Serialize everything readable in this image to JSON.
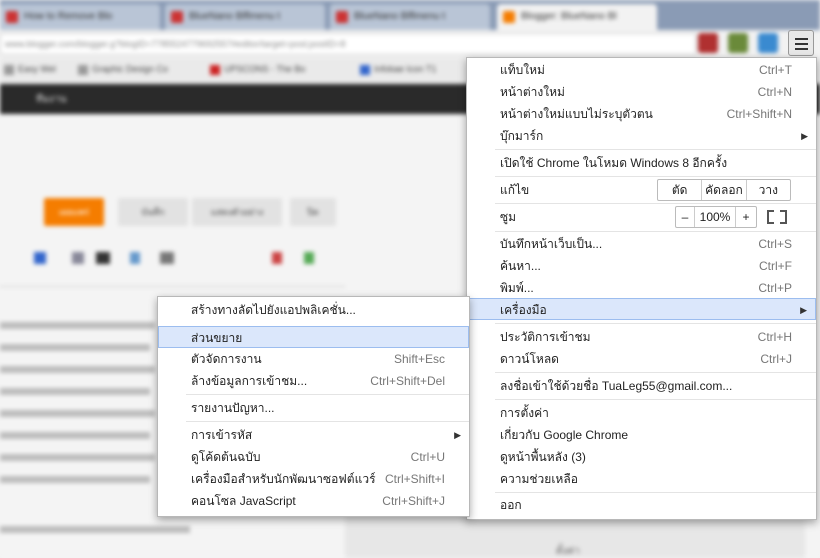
{
  "background": {
    "tabs": [
      {
        "label": "How to Remove Blo"
      },
      {
        "label": "BlueNano Blflmenu t"
      },
      {
        "label": "BlueNano Blflmenu t"
      },
      {
        "label": "Blogger: BlueNano Bl"
      }
    ],
    "omnibox_text": "www.blogger.com/blogger.g?blogID=7785524779692557#editor/target=post;postID=8",
    "bookmarks": [
      "Easy Wel",
      "Graphic Design Co",
      "UPSCONS - The Bo",
      "Infobae Icon T1"
    ],
    "darkbar": [
      "",
      "ทีมงาน"
    ],
    "editor_buttons": [
      "เผยแพร่",
      "บันทึก",
      "แสดงตัวอย่าง",
      "ปิด"
    ],
    "sidebar_label": "ตั้งค่า"
  },
  "main_menu": {
    "items": {
      "new_tab": {
        "label": "แท็บใหม่",
        "shortcut": "Ctrl+T"
      },
      "new_window": {
        "label": "หน้าต่างใหม่",
        "shortcut": "Ctrl+N"
      },
      "incognito": {
        "label": "หน้าต่างใหม่แบบไม่ระบุตัวตน",
        "shortcut": "Ctrl+Shift+N"
      },
      "bookmarks": {
        "label": "บุ๊กมาร์ก"
      },
      "win8": {
        "label": "เปิดใช้ Chrome ในโหมด Windows 8 อีกครั้ง"
      },
      "edit": {
        "label": "แก้ไข",
        "cut": "ตัด",
        "copy": "คัดลอก",
        "paste": "วาง"
      },
      "zoom": {
        "label": "ซูม",
        "minus": "–",
        "value": "100%",
        "plus": "+"
      },
      "save_page": {
        "label": "บันทึกหน้าเว็บเป็น...",
        "shortcut": "Ctrl+S"
      },
      "find": {
        "label": "ค้นหา...",
        "shortcut": "Ctrl+F"
      },
      "print": {
        "label": "พิมพ์...",
        "shortcut": "Ctrl+P"
      },
      "tools": {
        "label": "เครื่องมือ"
      },
      "history": {
        "label": "ประวัติการเข้าชม",
        "shortcut": "Ctrl+H"
      },
      "downloads": {
        "label": "ดาวน์โหลด",
        "shortcut": "Ctrl+J"
      },
      "signed_in": {
        "label": "ลงชื่อเข้าใช้ด้วยชื่อ TuaLeg55@gmail.com..."
      },
      "settings": {
        "label": "การตั้งค่า"
      },
      "about": {
        "label": "เกี่ยวกับ Google Chrome"
      },
      "background_pages": {
        "label": "ดูหน้าพื้นหลัง (3)"
      },
      "help": {
        "label": "ความช่วยเหลือ"
      },
      "exit": {
        "label": "ออก"
      }
    }
  },
  "tools_menu": {
    "items": {
      "create_shortcuts": {
        "label": "สร้างทางลัดไปยังแอปพลิเคชั่น..."
      },
      "extensions": {
        "label": "ส่วนขยาย"
      },
      "task_manager": {
        "label": "ตัวจัดการงาน",
        "shortcut": "Shift+Esc"
      },
      "clear_data": {
        "label": "ล้างข้อมูลการเข้าชม...",
        "shortcut": "Ctrl+Shift+Del"
      },
      "report_issue": {
        "label": "รายงานปัญหา..."
      },
      "encoding": {
        "label": "การเข้ารหัส"
      },
      "view_source": {
        "label": "ดูโค้ดต้นฉบับ",
        "shortcut": "Ctrl+U"
      },
      "dev_tools": {
        "label": "เครื่องมือสำหรับนักพัฒนาซอฟต์แวร์",
        "shortcut": "Ctrl+Shift+I"
      },
      "js_console": {
        "label": "คอนโซล JavaScript",
        "shortcut": "Ctrl+Shift+J"
      }
    }
  },
  "colors": {
    "highlight": "#dbe7fb",
    "highlight_border": "#9cbdef",
    "publish": "#f57d00"
  }
}
